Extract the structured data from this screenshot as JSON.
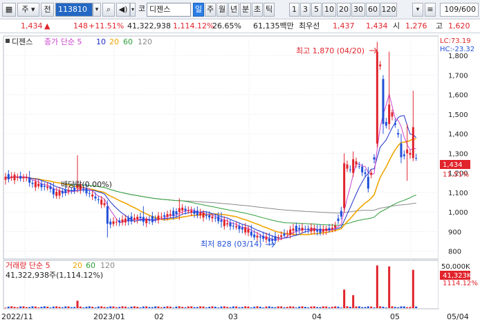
{
  "toolbar": {
    "type_btn": "주",
    "prev_btn": "전",
    "code": "113810",
    "name_prefix": "코",
    "stock_name": "디젠스",
    "periods": [
      "일",
      "주",
      "월",
      "년",
      "분",
      "초",
      "틱"
    ],
    "selected_period": "일",
    "intervals": [
      "1",
      "3",
      "5",
      "10",
      "20",
      "30",
      "60",
      "120"
    ],
    "count": "109/600"
  },
  "quote": {
    "price": "1,434",
    "change": "148",
    "change_pct": "+11.51%",
    "volume": "41,322,938",
    "volume_ratio": "1,114.12%",
    "turnover": "26.65%",
    "trade_value": "61,135백만",
    "ask_label": "최우선",
    "ask": "1,437",
    "bid": "1,434",
    "open_label": "시",
    "open": "1,276",
    "high_label": "고",
    "high": "1,620"
  },
  "chart": {
    "title": "디젠스",
    "ma_label": "종가 단순 5",
    "ma_periods": [
      "10",
      "20",
      "60",
      "120"
    ],
    "lc_label": "LC:73.19",
    "hc_label": "HC:-23.32",
    "annotation_high": "최고 1,870 (04/20)",
    "annotation_low": "최저 828 (03/14)",
    "annotation_dividend": "배당락(0.00%)",
    "price_tag": "1,434",
    "pct_tag": "11.51%",
    "volume_title": "거래량 단순 5",
    "volume_ma_periods": [
      "20",
      "60",
      "120"
    ],
    "volume_text": "41,322,938주(1,114.12%)",
    "volume_tag": "41,323K",
    "volume_pct_tag": "1114.12%",
    "colors": {
      "up": "#e1232b",
      "down": "#1f4fd8",
      "ma5": "#cc44cc",
      "ma10": "#1c2fc9",
      "ma20": "#f0a500",
      "ma60": "#2e9e3a",
      "ma120": "#8a8a8a"
    }
  },
  "chart_data": {
    "type": "candlestick",
    "price_axis": {
      "ticks": [
        "1,800",
        "1,700",
        "1,600",
        "1,500",
        "1,400",
        "1,300",
        "1,200",
        "1,100",
        "1,000",
        "900",
        "800"
      ],
      "range": [
        760,
        1900
      ]
    },
    "volume_axis": {
      "ticks": [
        "50,000K"
      ]
    },
    "x_labels": [
      "2022/11",
      "2023/01",
      "02",
      "03",
      "04",
      "05",
      "05/04"
    ],
    "ohlc_anchors": [
      {
        "i": 0,
        "o": 1165,
        "h": 1200,
        "l": 1140,
        "c": 1180
      },
      {
        "i": 8,
        "o": 1175,
        "h": 1210,
        "l": 1130,
        "c": 1150
      },
      {
        "i": 16,
        "o": 1120,
        "h": 1150,
        "l": 1070,
        "c": 1090
      },
      {
        "i": 24,
        "o": 1120,
        "h": 1290,
        "l": 1100,
        "c": 1140
      },
      {
        "i": 34,
        "o": 1030,
        "h": 1060,
        "l": 870,
        "c": 940
      },
      {
        "i": 46,
        "o": 975,
        "h": 1030,
        "l": 930,
        "c": 950
      },
      {
        "i": 58,
        "o": 1000,
        "h": 1070,
        "l": 960,
        "c": 1020
      },
      {
        "i": 72,
        "o": 960,
        "h": 1000,
        "l": 920,
        "c": 950
      },
      {
        "i": 82,
        "o": 900,
        "h": 935,
        "l": 870,
        "c": 880
      },
      {
        "i": 88,
        "o": 865,
        "h": 895,
        "l": 828,
        "c": 850
      },
      {
        "i": 96,
        "o": 905,
        "h": 940,
        "l": 880,
        "c": 915
      },
      {
        "i": 104,
        "o": 910,
        "h": 935,
        "l": 880,
        "c": 900
      },
      {
        "i": 110,
        "o": 920,
        "h": 950,
        "l": 900,
        "c": 930
      },
      {
        "i": 113,
        "o": 1020,
        "h": 1300,
        "l": 1000,
        "c": 1250
      },
      {
        "i": 116,
        "o": 1200,
        "h": 1310,
        "l": 1180,
        "c": 1270
      },
      {
        "i": 121,
        "o": 1180,
        "h": 1230,
        "l": 1100,
        "c": 1120
      },
      {
        "i": 124,
        "o": 1350,
        "h": 1870,
        "l": 1330,
        "c": 1820
      },
      {
        "i": 126,
        "o": 1680,
        "h": 1700,
        "l": 1400,
        "c": 1450
      },
      {
        "i": 128,
        "o": 1450,
        "h": 1820,
        "l": 1420,
        "c": 1550
      },
      {
        "i": 132,
        "o": 1350,
        "h": 1400,
        "l": 1250,
        "c": 1280
      },
      {
        "i": 134,
        "o": 1300,
        "h": 1450,
        "l": 1160,
        "c": 1320
      },
      {
        "i": 136,
        "o": 1276,
        "h": 1620,
        "l": 1260,
        "c": 1434
      }
    ],
    "volume_spikes": [
      {
        "i": 24,
        "v": 8000
      },
      {
        "i": 113,
        "v": 20000
      },
      {
        "i": 116,
        "v": 14000
      },
      {
        "i": 124,
        "v": 46000
      },
      {
        "i": 128,
        "v": 45000
      },
      {
        "i": 136,
        "v": 41323
      }
    ]
  }
}
